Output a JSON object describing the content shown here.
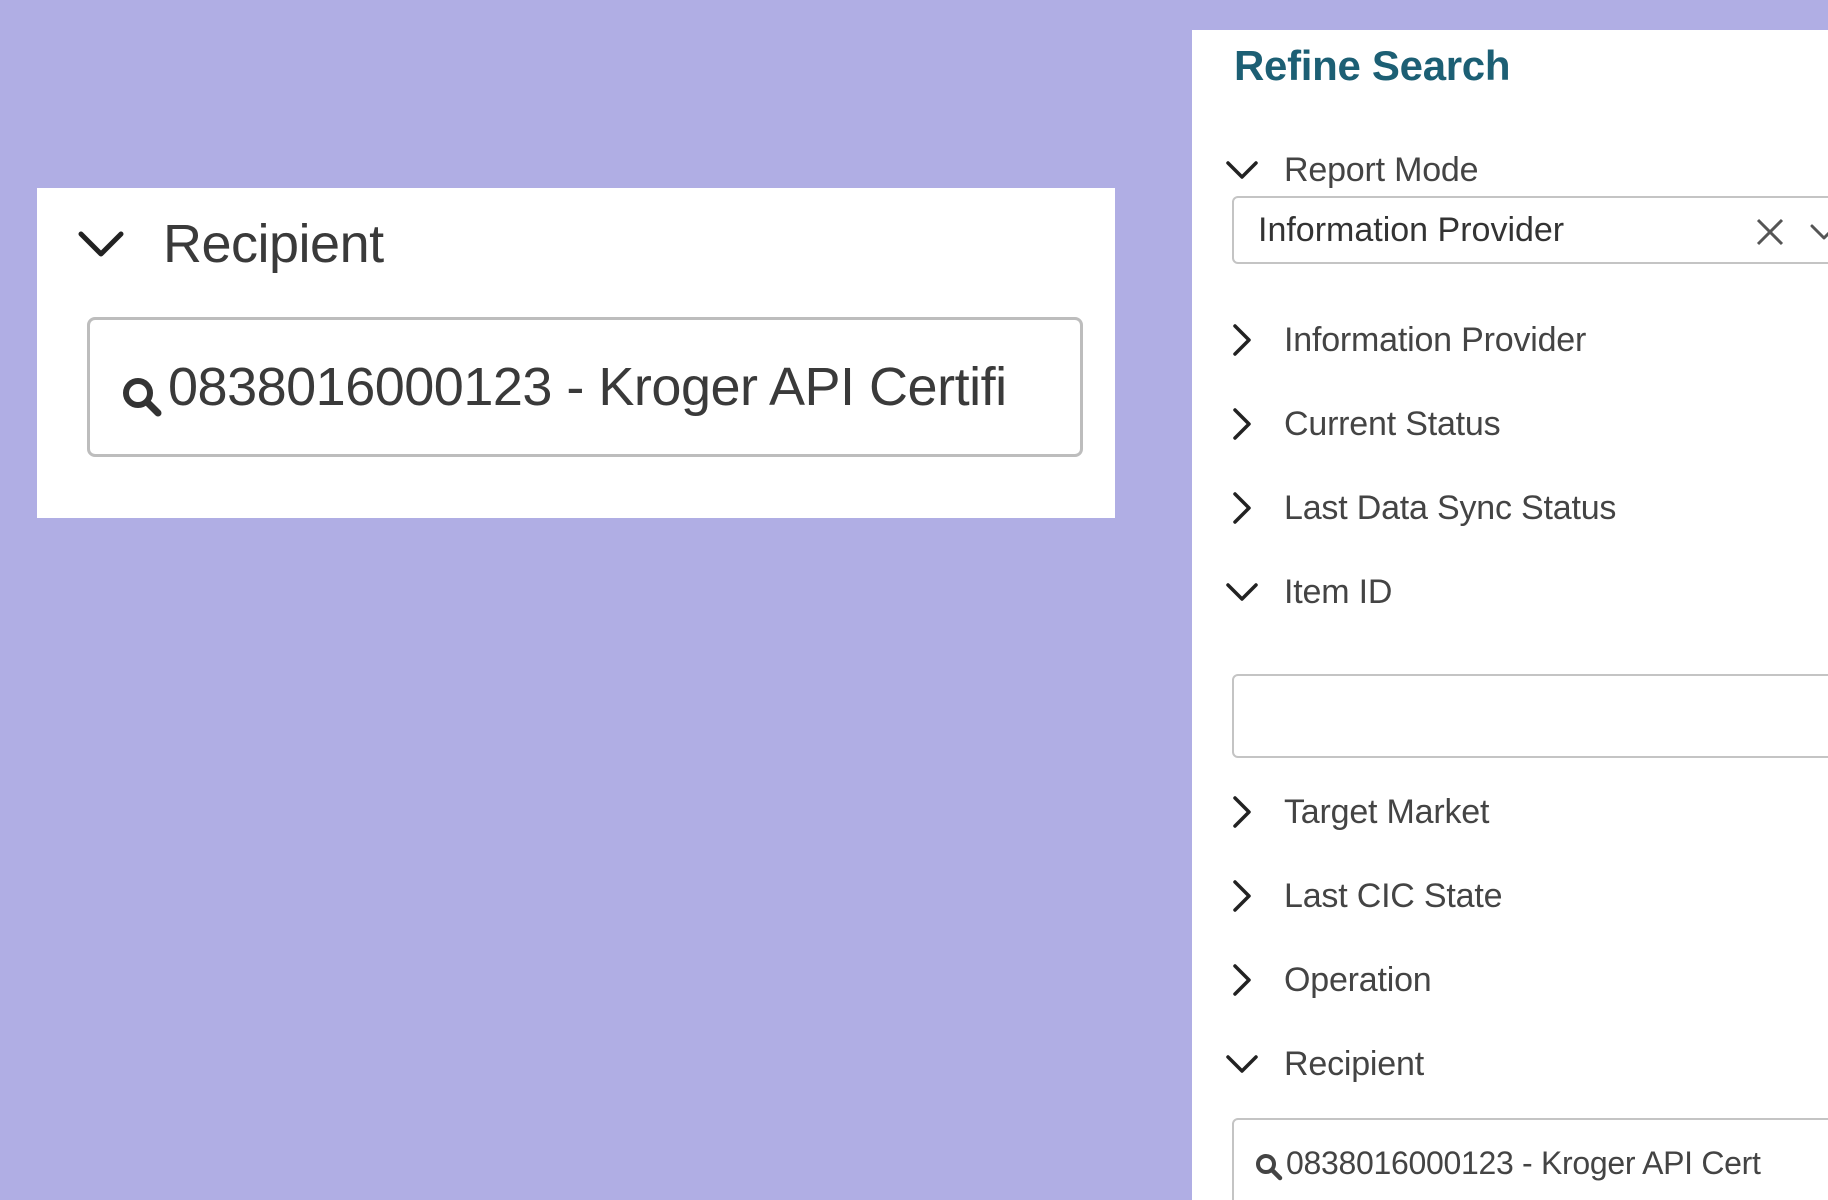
{
  "callout": {
    "section_label": "Recipient",
    "search_value": "0838016000123 - Kroger API Certifi"
  },
  "refine": {
    "title": "Refine Search",
    "report_mode": {
      "label": "Report Mode",
      "selected": "Information Provider"
    },
    "sections": {
      "information_provider": "Information Provider",
      "current_status": "Current Status",
      "last_data_sync_status": "Last Data Sync Status",
      "item_id": "Item ID",
      "target_market": "Target Market",
      "last_cic_state": "Last CIC State",
      "operation": "Operation",
      "recipient": "Recipient"
    },
    "item_id_value": "",
    "recipient_value": "0838016000123 - Kroger API Cert"
  },
  "icons": {
    "expanded": "chevron-down-icon",
    "collapsed": "chevron-right-icon",
    "search": "search-icon",
    "clear": "close-icon"
  },
  "colors": {
    "background": "#b0aee4",
    "title": "#1c5f74",
    "panel": "#ffffff"
  }
}
